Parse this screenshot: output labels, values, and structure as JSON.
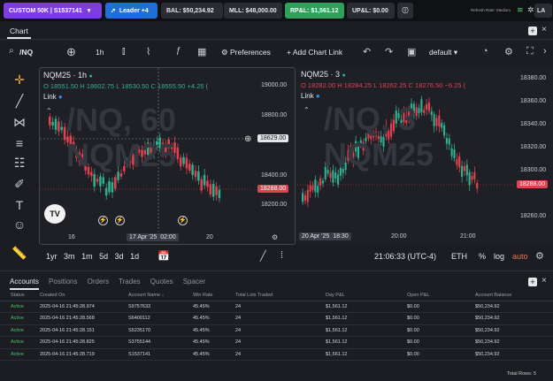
{
  "topbar": {
    "account": "CUSTOM 50K | S1537141",
    "leader": "Leader +4",
    "bal": "BAL: $50,234.92",
    "mll": "MLL: $48,000.00",
    "rpl": "RP&L: $1,561.12",
    "upl": "UP&L: $0.00",
    "refresh": "Refresh Rate: Medium",
    "lang": "LA"
  },
  "charttab": {
    "title": "Chart"
  },
  "toolbar": {
    "symbol": "/NQ",
    "interval": "1h",
    "preferences": "Preferences",
    "addlink": "Add Chart Link",
    "layout": "default"
  },
  "left_chart": {
    "title": "NQM25 · 1h",
    "o": "O 18551.50",
    "h": "H 18602.75",
    "l": "L 18530.50",
    "c": "C 18555.50",
    "chg": "+4.25 (",
    "link": "Link",
    "wm1": "/NQ, 60",
    "wm2": "NQM25",
    "ticks": [
      "19000.00",
      "18800.00",
      "18600.00",
      "18400.00",
      "18200.00"
    ],
    "cross": "18629.00",
    "last": "18288.00",
    "xlabels": [
      "16",
      "17 Apr '25",
      "02:00",
      "20"
    ]
  },
  "right_chart": {
    "title": "NQM25 · 3",
    "o": "O 18282.00",
    "h": "H 18284.25",
    "l": "L 18262.25",
    "c": "C 18276.50",
    "chg": "−6.25 (",
    "link": "Link",
    "wm1": "/NQ, 3",
    "wm2": "NQM25",
    "ticks": [
      "18380.00",
      "18360.00",
      "18340.00",
      "18320.00",
      "18300.00",
      "18280.00",
      "18260.00"
    ],
    "last": "18288.00",
    "xlabels": [
      "20 Apr '25",
      "18:30",
      "20:00",
      "21:00"
    ]
  },
  "bottombar": {
    "ranges": [
      "1yr",
      "3m",
      "1m",
      "5d",
      "3d",
      "1d"
    ],
    "time": "21:06:33 (UTC-4)",
    "sym": "ETH",
    "pct": "%",
    "log": "log",
    "auto": "auto"
  },
  "bottomtabs": [
    "Accounts",
    "Positions",
    "Orders",
    "Trades",
    "Quotes",
    "Spacer"
  ],
  "table": {
    "headers": [
      "Status",
      "Created On",
      "Account Name",
      "Win Rate",
      "Total Lots Traded",
      "Day P&L",
      "Open P&L",
      "Account Balance"
    ],
    "rows": [
      [
        "Active",
        "2025-04-16 21:45:28.974",
        "S9757633",
        "45.45%",
        "24",
        "$1,561.12",
        "$0.00",
        "$50,234.92"
      ],
      [
        "Active",
        "2025-04-16 21:45:28.568",
        "S6400112",
        "45.45%",
        "24",
        "$1,561.12",
        "$0.00",
        "$50,234.92"
      ],
      [
        "Active",
        "2025-04-16 21:45:28.151",
        "S5235170",
        "45.45%",
        "24",
        "$1,561.12",
        "$0.00",
        "$50,234.92"
      ],
      [
        "Active",
        "2025-04-16 21:45:28.825",
        "S3755144",
        "45.45%",
        "24",
        "$1,561.12",
        "$0.00",
        "$50,234.92"
      ],
      [
        "Active",
        "2025-04-16 21:45:28.719",
        "S1537141",
        "45.45%",
        "24",
        "$1,561.12",
        "$0.00",
        "$50,234.92"
      ]
    ],
    "total": "Total Rows: 5"
  },
  "colors": {
    "up": "#2fb08d",
    "down": "#e2414f",
    "accent": "#7d3de0",
    "link": "#3f8be0"
  }
}
